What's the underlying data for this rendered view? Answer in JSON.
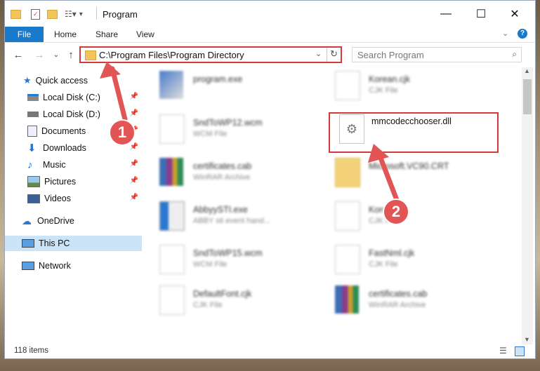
{
  "window": {
    "title": "Program"
  },
  "ribbon": {
    "file": "File",
    "home": "Home",
    "share": "Share",
    "view": "View"
  },
  "address": {
    "path": "C:\\Program Files\\Program Directory"
  },
  "search": {
    "placeholder": "Search Program"
  },
  "sidebar": {
    "items": [
      {
        "label": "Quick access"
      },
      {
        "label": "Local Disk (C:)"
      },
      {
        "label": "Local Disk (D:)"
      },
      {
        "label": "Documents"
      },
      {
        "label": "Downloads"
      },
      {
        "label": "Music"
      },
      {
        "label": "Pictures"
      },
      {
        "label": "Videos"
      },
      {
        "label": "OneDrive"
      },
      {
        "label": "This PC"
      },
      {
        "label": "Network"
      }
    ]
  },
  "files": [
    {
      "name": "program.exe",
      "type": ""
    },
    {
      "name": "Korean.cjk",
      "type": "CJK File"
    },
    {
      "name": "SndToWP12.wcm",
      "type": "WCM File"
    },
    {
      "name": "mmcodecchooser.dll",
      "type": ""
    },
    {
      "name": "certificates.cab",
      "type": "WinRAR Archive"
    },
    {
      "name": "Microsoft.VC90.CRT",
      "type": ""
    },
    {
      "name": "AbbyySTI.exe",
      "type": "ABBY sti event hand..."
    },
    {
      "name": "Korean",
      "type": "CJK File"
    },
    {
      "name": "SndToWP15.wcm",
      "type": "WCM File"
    },
    {
      "name": "FastNml.cjk",
      "type": "CJK File"
    },
    {
      "name": "DefaultFont.cjk",
      "type": "CJK File"
    },
    {
      "name": "certificates.cab",
      "type": "WinRAR Archive"
    }
  ],
  "status": {
    "count": "118 items"
  },
  "annotations": {
    "step1": "1",
    "step2": "2",
    "color": "#e25555"
  }
}
